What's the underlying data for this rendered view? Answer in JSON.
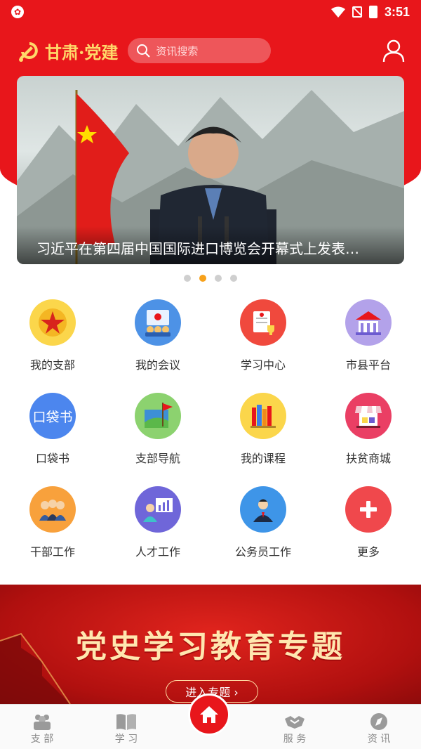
{
  "status_bar": {
    "time": "3:51"
  },
  "header": {
    "logo_text": "甘肃·党建",
    "search_placeholder": "资讯搜索"
  },
  "banner": {
    "caption": "习近平在第四届中国国际进口博览会开幕式上发表…",
    "slides": 4,
    "active_slide": 2
  },
  "grid": [
    [
      {
        "label": "我的支部",
        "icon": "party-star-icon",
        "color": "#fbd64b"
      },
      {
        "label": "我的会议",
        "icon": "meeting-icon",
        "color": "#4d92e6"
      },
      {
        "label": "学习中心",
        "icon": "study-certificate-icon",
        "color": "#f0493d"
      },
      {
        "label": "市县平台",
        "icon": "government-building-icon",
        "color": "#b3a2ea"
      }
    ],
    [
      {
        "label": "口袋书",
        "icon": "pocket-book-icon",
        "color": "#4c86ee",
        "text": "口袋书"
      },
      {
        "label": "支部导航",
        "icon": "map-flag-icon",
        "color": "#8cd26f"
      },
      {
        "label": "我的课程",
        "icon": "books-icon",
        "color": "#fbd64b"
      },
      {
        "label": "扶贫商城",
        "icon": "shop-stall-icon",
        "color": "#ea3f64"
      }
    ],
    [
      {
        "label": "干部工作",
        "icon": "cadres-icon",
        "color": "#f8a13c"
      },
      {
        "label": "人才工作",
        "icon": "talent-chart-icon",
        "color": "#6f66d9"
      },
      {
        "label": "公务员工作",
        "icon": "civil-servant-icon",
        "color": "#3e95e8"
      },
      {
        "label": "更多",
        "icon": "plus-icon",
        "color": "#f0484c"
      }
    ]
  ],
  "promo": {
    "title": "党史学习教育专题",
    "button": "进入专题 ›"
  },
  "tabbar": [
    {
      "label": "支 部",
      "icon": "people-icon"
    },
    {
      "label": "学 习",
      "icon": "book-icon"
    },
    {
      "label": "",
      "icon": "home-icon"
    },
    {
      "label": "服 务",
      "icon": "handshake-icon"
    },
    {
      "label": "资 讯",
      "icon": "compass-icon"
    }
  ]
}
